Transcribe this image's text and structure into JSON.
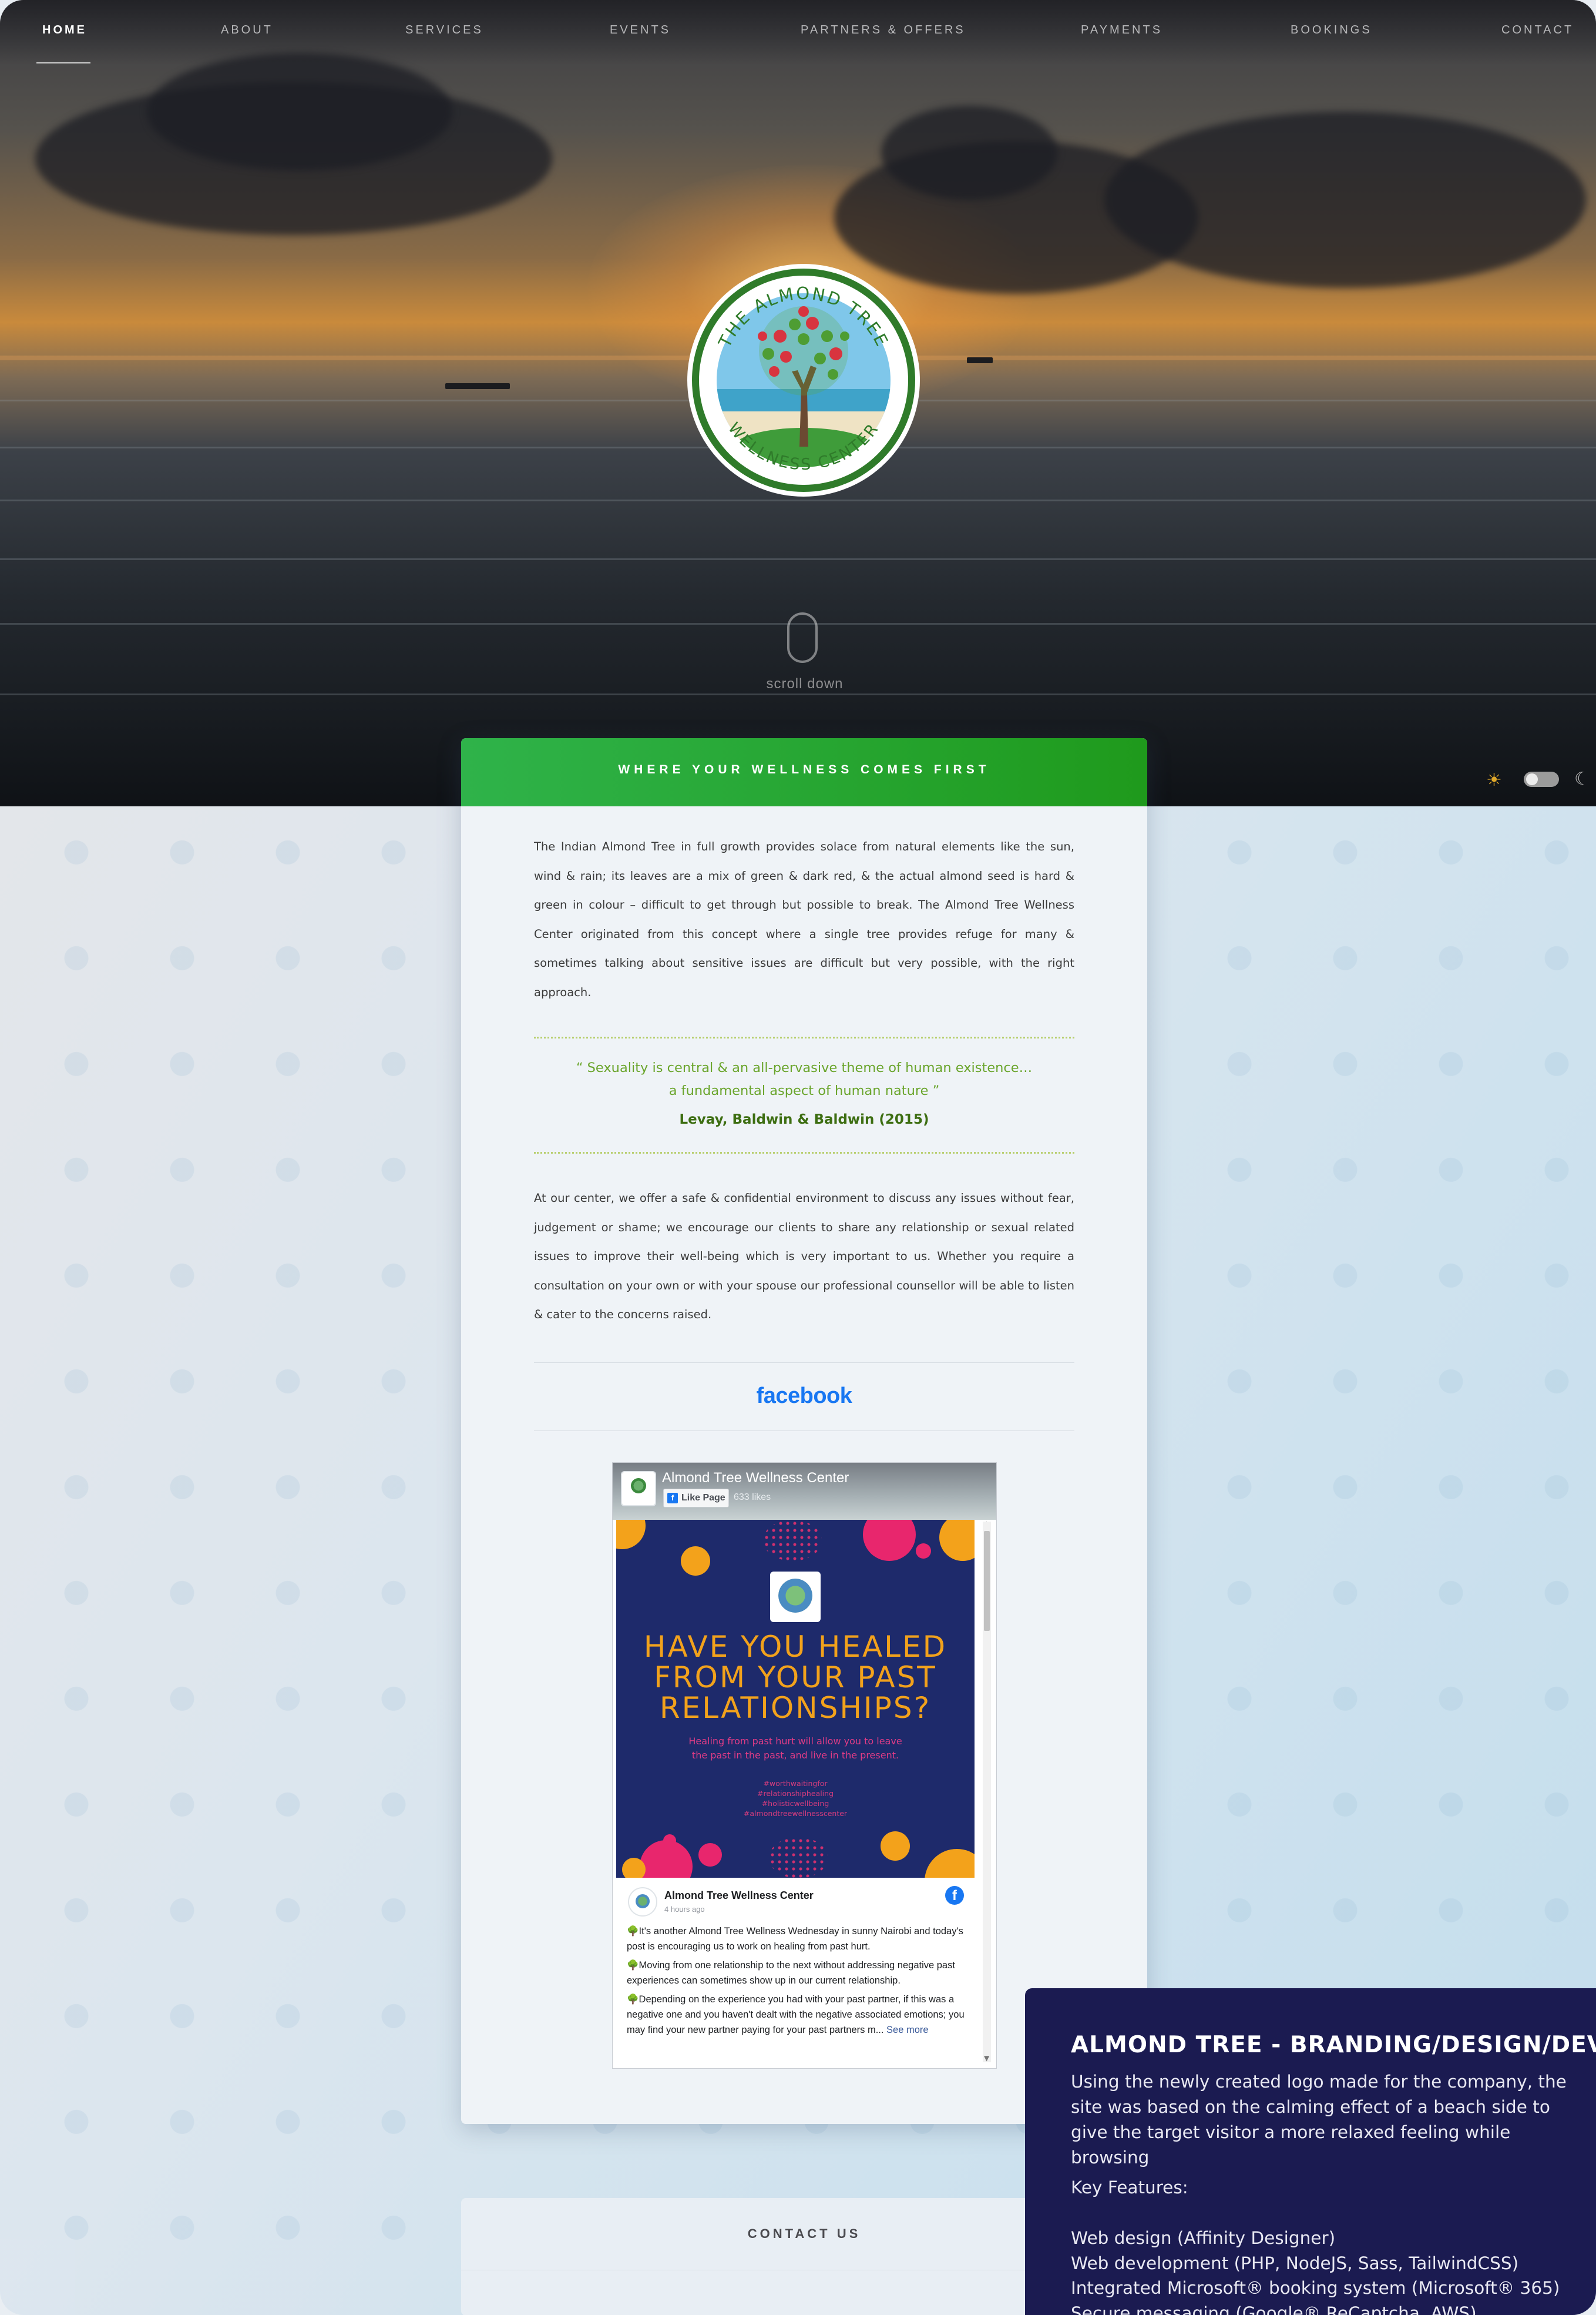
{
  "nav": {
    "items": [
      {
        "label": "HOME",
        "active": true
      },
      {
        "label": "ABOUT",
        "active": false
      },
      {
        "label": "SERVICES",
        "active": false
      },
      {
        "label": "EVENTS",
        "active": false
      },
      {
        "label": "PARTNERS & OFFERS",
        "active": false
      },
      {
        "label": "PAYMENTS",
        "active": false
      },
      {
        "label": "BOOKINGS",
        "active": false
      },
      {
        "label": "CONTACT",
        "active": false
      }
    ]
  },
  "hero": {
    "logo_top_text": "THE ALMOND TREE",
    "logo_bottom_text": "WELLNESS CENTER",
    "scroll_label": "scroll down"
  },
  "theme_toggle": {
    "light_icon": "sun-icon",
    "dark_icon": "moon-icon",
    "state": "light"
  },
  "card": {
    "heading": "WHERE YOUR WELLNESS COMES FIRST",
    "intro": "The Indian Almond Tree in full growth provides solace from natural elements like the sun, wind & rain; its leaves are a mix of green & dark red, & the actual almond seed is hard & green in colour – difficult to get through but possible to break. The Almond Tree Wellness Center originated from this concept where a single tree provides refuge for many & sometimes talking about sensitive issues are difficult but very possible, with the right approach.",
    "quote_line1": "“ Sexuality is central & an all-pervasive theme of human existence…",
    "quote_line2": "a fundamental aspect of human nature ”",
    "quote_author": "Levay, Baldwin & Baldwin (2015)",
    "body": "At our center, we offer a safe & confidential environment to discuss any issues without fear, judgement or shame; we encourage our clients to share any relationship or sexual related issues to improve their well-being which is very important to us. Whether you require a consultation on your own or with your spouse our professional counsellor will be able to listen & cater to the concerns raised.",
    "facebook_label": "facebook"
  },
  "fb_embed": {
    "page_name": "Almond Tree Wellness Center",
    "like_label": "Like Page",
    "likes": "633 likes",
    "post_image": {
      "headline_1": "HAVE YOU HEALED",
      "headline_2": "FROM YOUR PAST",
      "headline_3": "RELATIONSHIPS?",
      "sub_1": "Healing from past hurt will allow you to leave",
      "sub_2": "the past in the past, and live in the present.",
      "tag_1": "#worthwaitingfor",
      "tag_2": "#relationshiphealing",
      "tag_3": "#holisticwellbeing",
      "tag_4": "#almondtreewellnesscenter"
    },
    "post_author": "Almond Tree Wellness Center",
    "post_time": "4 hours ago",
    "post_p1": "🌳It's another Almond Tree Wellness Wednesday in sunny Nairobi and today's post is encouraging us to work on healing from past hurt.",
    "post_p2": "🌳Moving from one relationship to the next without addressing negative past experiences can sometimes show up in our current relationship.",
    "post_p3": "🌳Depending on the experience you had with your past partner, if this was a negative one and you haven't dealt with the negative associated emotions; you may find your new partner paying for your past partners m...",
    "see_more": "See more"
  },
  "contact": {
    "heading": "CONTACT US"
  },
  "info_panel": {
    "title": "ALMOND TREE - BRANDING/DESIGN/DEVELOPMENT",
    "description": "Using the newly created logo made for the company, the site was based on the calming effect of a beach side to give the target visitor a more relaxed feeling while browsing",
    "features_label": "Key Features:",
    "features": [
      "Web design (Affinity Designer)",
      "Web development (PHP, NodeJS, Sass, TailwindCSS)",
      "Integrated Microsoft® booking system (Microsoft® 365)",
      "Secure messaging (Google® ReCaptcha, AWS)"
    ]
  },
  "colors": {
    "accent_green": "#1f9a1c",
    "quote_green": "#6aa52c",
    "facebook_blue": "#1877f2",
    "info_panel_bg": "#1b1b51"
  }
}
